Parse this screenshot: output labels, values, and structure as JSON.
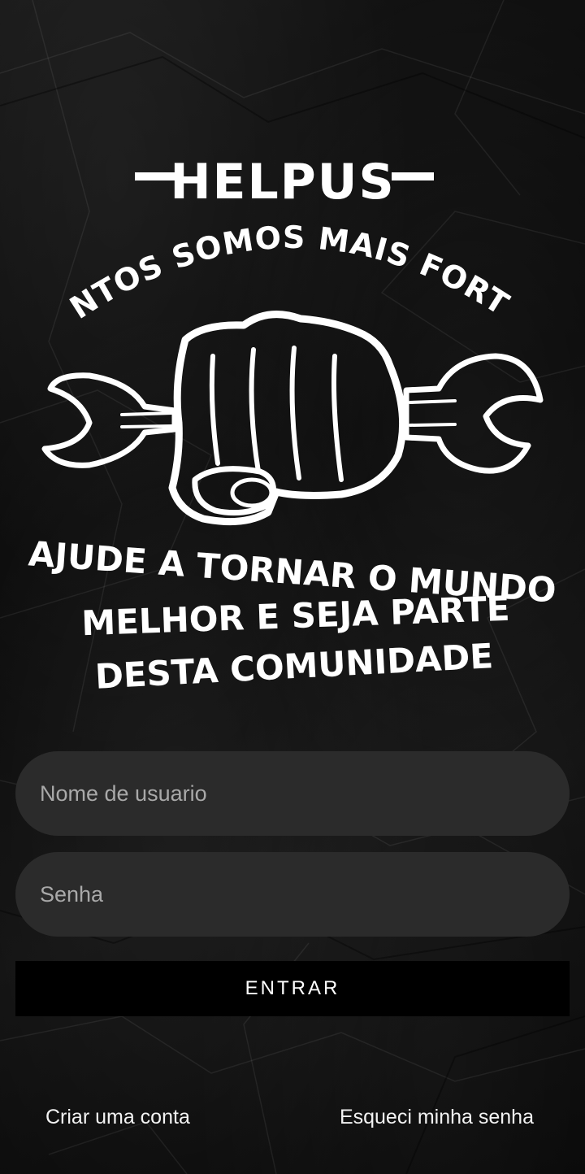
{
  "logo": {
    "title": "HELPUS",
    "tagline": "JUNTOS SOMOS MAIS FORTES",
    "message_line_1": "AJUDE A TORNAR O MUNDO",
    "message_line_2": "MELHOR E SEJA PARTE",
    "message_line_3": "DESTA COMUNIDADE",
    "icon": "fist-wrench-icon"
  },
  "form": {
    "username_placeholder": "Nome de usuario",
    "password_placeholder": "Senha",
    "submit_label": "ENTRAR"
  },
  "footer": {
    "create_account_label": "Criar uma conta",
    "forgot_password_label": "Esqueci minha senha"
  },
  "colors": {
    "background": "#0c0c0c",
    "field_background": "#2b2b2b",
    "button_background": "#000000",
    "text": "#ffffff"
  }
}
